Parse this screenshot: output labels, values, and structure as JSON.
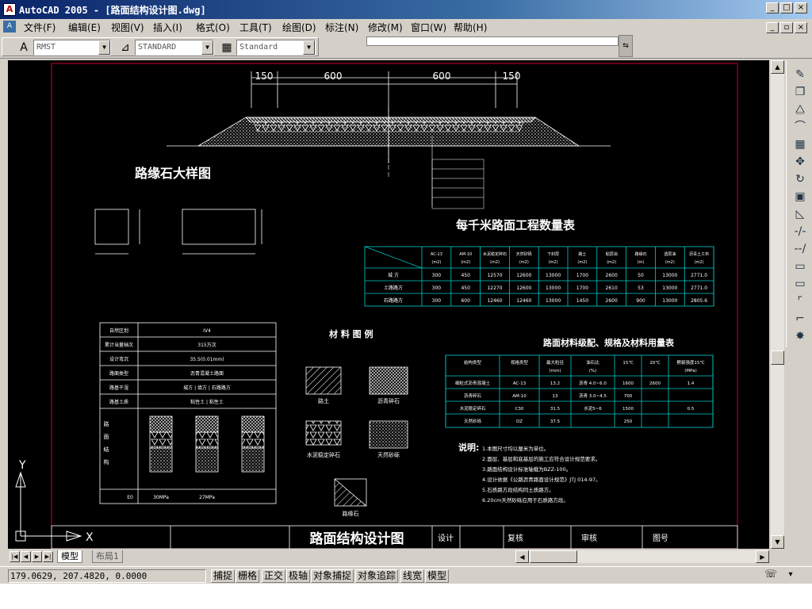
{
  "window": {
    "title": "AutoCAD 2005 - [路面结构设计图.dwg]",
    "icon": "autocad-icon",
    "controls": [
      "_",
      "□",
      "×"
    ]
  },
  "menu": {
    "items": [
      "文件(F)",
      "编辑(E)",
      "视图(V)",
      "插入(I)",
      "格式(O)",
      "工具(T)",
      "绘图(D)",
      "标注(N)",
      "修改(M)",
      "窗口(W)",
      "帮助(H)"
    ]
  },
  "toolbar": {
    "text_style": "RMST",
    "dim_style": "STANDARD",
    "table_style": "Standard"
  },
  "drawing": {
    "dims_top": [
      "150",
      "600",
      "600",
      "150"
    ],
    "curb_title": "路缘石大样图",
    "material_legend_title": "材 料 图 例",
    "legend_items": [
      "路土",
      "沥青碎石",
      "水泥稳定碎石",
      "天然砂砾",
      "路缘石"
    ],
    "qty_table_title": "每千米路面工程数量表",
    "qty_table": {
      "headers": [
        "AC-13(m2)",
        "AM-10(m2)",
        "水泥稳定碎石(m2)",
        "天然砂砾(m2)",
        "下封层(m2)",
        "路土(m2)",
        "粘层油(m2)",
        "路缘石(m)",
        "透层油(m2)",
        "沥青土工布(m2)"
      ],
      "rows": [
        {
          "label": "城 方",
          "values": [
            "300",
            "450",
            "12570",
            "12600",
            "13000",
            "1700",
            "2600",
            "50",
            "13000",
            "2771.0"
          ]
        },
        {
          "label": "土路路方",
          "values": [
            "300",
            "450",
            "12270",
            "12600",
            "13000",
            "1700",
            "2610",
            "53",
            "13000",
            "2771.0"
          ]
        },
        {
          "label": "石路路方",
          "values": [
            "300",
            "600",
            "12460",
            "12460",
            "13000",
            "1450",
            "2600",
            "900",
            "13000",
            "2805.6"
          ]
        }
      ]
    },
    "mat_table_title": "路面材料级配、规格及材料用量表",
    "mat_table": {
      "headers": [
        "结构类型",
        "规格类型",
        "最大粒径(mm)",
        "油石比(%)",
        "15℃",
        "20℃",
        "劈裂强度15℃(MPa)"
      ],
      "rows": [
        [
          "细粒式沥青混凝土",
          "AC-13",
          "13.2",
          "沥青 4.0~6.0",
          "1600",
          "2600",
          "1.4"
        ],
        [
          "沥青碎石",
          "AM-10",
          "13",
          "沥青 3.0~4.5",
          "700",
          "",
          ""
        ],
        [
          "水泥稳定碎石",
          "C30",
          "31.5",
          "水泥5~6",
          "1500",
          "",
          "0.5"
        ],
        [
          "天然砂砾",
          "DZ",
          "37.5",
          "",
          "250",
          "",
          ""
        ]
      ]
    },
    "left_table": {
      "rows": [
        [
          "自然区划",
          "IV4"
        ],
        [
          "累计当量轴次",
          "315万次"
        ],
        [
          "设计弯沉",
          "35.5(0.01mm)"
        ],
        [
          "路面类型",
          "沥青混凝土路面"
        ],
        [
          "路基干湿",
          "城方 | 填方 | 石路路方"
        ],
        [
          "路基土质",
          "粘性土 | 粘性土"
        ]
      ],
      "side_label": "路面结构",
      "bottom": [
        "E0",
        "30MPa",
        "27MPa"
      ]
    },
    "notes_label": "说明:",
    "notes": [
      "1.本图尺寸均以厘米为单位。",
      "2.面层、基层和底基层的施工应符合设计规范要求。",
      "3.路面结构设计标准轴载为BZZ-100。",
      "4.设计依据《公路沥青路面设计规范》JTJ 014-97。",
      "5.石质路方段结构同土质路方。",
      "6.20cm天然砂砾应用于石质路方段。"
    ],
    "titleblock": {
      "title": "路面结构设计图",
      "design": "设计",
      "review": "复核",
      "check": "审核",
      "drawing_no": "图号"
    },
    "ucs": {
      "x": "X",
      "y": "Y"
    }
  },
  "tabs": {
    "model": "模型",
    "layout": "布局1"
  },
  "status": {
    "coords": "179.0629, 207.4820, 0.0000",
    "buttons": [
      "捕捉",
      "栅格",
      "正交",
      "极轴",
      "对象捕捉",
      "对象追踪",
      "线宽",
      "模型"
    ]
  }
}
